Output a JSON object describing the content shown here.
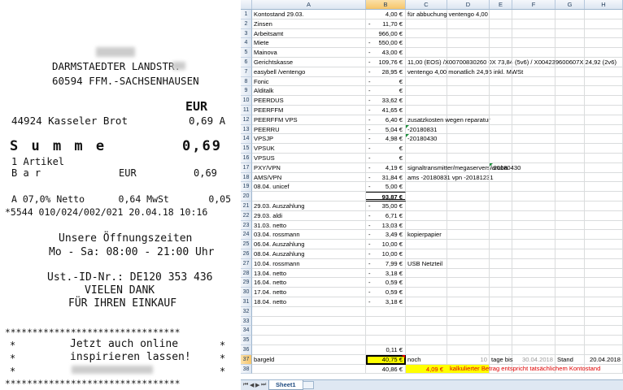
{
  "receipt": {
    "store_address_line1": "DARMSTAEDTER LANDSTR.",
    "store_address_line2": "60594 FFM.-SACHSENHAUSEN",
    "currency_header": "EUR",
    "item": {
      "code_name": "44924 Kasseler Brot",
      "price": "0,69 A"
    },
    "summe_label": "S u m m e",
    "summe_value": "0,69",
    "article_count": "1 Artikel",
    "payment_method": "B a r",
    "payment_currency": "EUR",
    "payment_value": "0,69",
    "tax_line": "A 07,0% Netto      0,64 MwSt       0,05",
    "transaction_line": "*5544 010/024/002/021 20.04.18 10:16",
    "hours_title": "Unsere Öffnungszeiten",
    "hours": "Mo - Sa: 08:00 - 21:00 Uhr",
    "vat_id": "Ust.-ID-Nr.: DE120 353 436",
    "thanks1": "VIELEN DANK",
    "thanks2": "FÜR IHREN EINKAUF",
    "stars": "********************************",
    "promo1": "Jetzt auch online",
    "promo2": "inspirieren lassen!",
    "star": "*"
  },
  "sheet": {
    "columns": [
      "A",
      "B",
      "C",
      "D",
      "E",
      "F",
      "G",
      "H"
    ],
    "selected_column": "B",
    "selected_row": "37",
    "tab_name": "Sheet1",
    "rows": [
      {
        "n": "1",
        "a": "Kontostand 29.03.",
        "sign": "",
        "b": "4,00 €",
        "c": "für abbuchung ventengo 4,00"
      },
      {
        "n": "2",
        "a": "Zinsen",
        "sign": "-",
        "b": "11,70 €",
        "c": ""
      },
      {
        "n": "3",
        "a": "Arbeitsamt",
        "sign": "",
        "b": "966,00 €",
        "c": ""
      },
      {
        "n": "4",
        "a": "Miete",
        "sign": "-",
        "b": "550,00 €",
        "c": ""
      },
      {
        "n": "5",
        "a": "Mainova",
        "sign": "-",
        "b": "43,00 €",
        "c": ""
      },
      {
        "n": "6",
        "a": "Gerichtskasse",
        "sign": "-",
        "b": "109,76 €",
        "c": "11,00 (EOS) /X00700830260 0X 73,84 (5v6) / X004239600607X 24,92 (2v6)"
      },
      {
        "n": "7",
        "a": "easybell /ventengo",
        "sign": "-",
        "b": "28,95 €",
        "c": "ventengo 4,00 monatlich 24,95 inkl. MWSt"
      },
      {
        "n": "8",
        "a": "Fonic",
        "sign": "-",
        "b": "€",
        "c": ""
      },
      {
        "n": "9",
        "a": "Alditalk",
        "sign": "-",
        "b": "€",
        "c": ""
      },
      {
        "n": "10",
        "a": "PEERDUS",
        "sign": "-",
        "b": "33,62 €",
        "c": ""
      },
      {
        "n": "11",
        "a": "PEERFFM",
        "sign": "-",
        "b": "41,65 €",
        "c": ""
      },
      {
        "n": "12",
        "a": "PEERFFM VPS",
        "sign": "-",
        "b": "6,40 €",
        "c": "zusatzkosten wegen reparatur"
      },
      {
        "n": "13",
        "a": "PEERRU",
        "sign": "-",
        "b": "5,04 €",
        "c": "-20180831"
      },
      {
        "n": "14",
        "a": "VPSJP",
        "sign": "-",
        "b": "4,98 €",
        "c": "-20180430"
      },
      {
        "n": "15",
        "a": "VPSUK",
        "sign": "-",
        "b": "€",
        "c": ""
      },
      {
        "n": "16",
        "a": "VPSUS",
        "sign": "-",
        "b": "€",
        "c": ""
      },
      {
        "n": "17",
        "a": "PXY/VPN",
        "sign": "-",
        "b": "4,19 €",
        "c": "signaltransmitter/megaservers/aruba",
        "e": "-20180430"
      },
      {
        "n": "18",
        "a": "AMS/VPN",
        "sign": "-",
        "b": "31,84 €",
        "c": "ams -20180831 vpn -20181231"
      },
      {
        "n": "19",
        "a": "08.04. unicef",
        "sign": "-",
        "b": "5,00 €",
        "c": ""
      },
      {
        "n": "20",
        "a": "",
        "sign": "",
        "b": "93,87 €",
        "c": "",
        "total": true
      },
      {
        "n": "21",
        "a": "29.03. Auszahlung",
        "sign": "-",
        "b": "35,00 €",
        "c": ""
      },
      {
        "n": "22",
        "a": "29.03. aldi",
        "sign": "-",
        "b": "6,71 €",
        "c": ""
      },
      {
        "n": "23",
        "a": "31.03. netto",
        "sign": "-",
        "b": "13,03 €",
        "c": ""
      },
      {
        "n": "24",
        "a": "03.04. rossmann",
        "sign": "-",
        "b": "3,49 €",
        "c": "kopierpapier"
      },
      {
        "n": "25",
        "a": "06.04. Auszahlung",
        "sign": "-",
        "b": "10,00 €",
        "c": ""
      },
      {
        "n": "26",
        "a": "08.04. Auszahlung",
        "sign": "-",
        "b": "10,00 €",
        "c": ""
      },
      {
        "n": "27",
        "a": "10.04. rossmann",
        "sign": "-",
        "b": "7,99 €",
        "c": "USB Netzteil"
      },
      {
        "n": "28",
        "a": "13.04. netto",
        "sign": "-",
        "b": "3,18 €",
        "c": ""
      },
      {
        "n": "29",
        "a": "16.04. netto",
        "sign": "-",
        "b": "0,59 €",
        "c": ""
      },
      {
        "n": "30",
        "a": "17.04. netto",
        "sign": "-",
        "b": "0,59 €",
        "c": ""
      },
      {
        "n": "31",
        "a": "18.04. netto",
        "sign": "-",
        "b": "3,18 €",
        "c": ""
      },
      {
        "n": "32",
        "a": "",
        "sign": "",
        "b": "",
        "c": ""
      },
      {
        "n": "33",
        "a": "",
        "sign": "",
        "b": "",
        "c": ""
      },
      {
        "n": "34",
        "a": "",
        "sign": "",
        "b": "",
        "c": ""
      },
      {
        "n": "35",
        "a": "",
        "sign": "",
        "b": "",
        "c": ""
      },
      {
        "n": "36",
        "a": "",
        "sign": "",
        "b": "0,11 €",
        "c": ""
      },
      {
        "n": "37",
        "a": "bargeld",
        "sign": "",
        "b": "40,75 €",
        "c": "noch",
        "d": "10",
        "e": "tage bis",
        "f": "30.04.2018",
        "g": "Stand",
        "h": "20.04.2018",
        "highlight": true,
        "active": true
      },
      {
        "n": "38",
        "a": "",
        "sign": "",
        "b": "40,86 €",
        "c": "",
        "d": "4,09 €",
        "note": "kalkulierter Betrag entspricht tatsächlichem Kontostand"
      }
    ]
  }
}
